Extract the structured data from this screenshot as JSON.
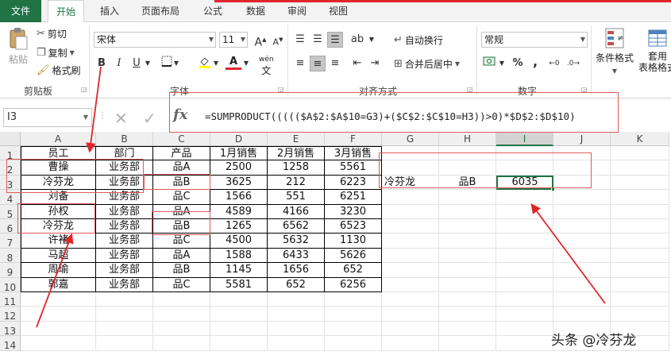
{
  "tabs": [
    {
      "label": "文件"
    },
    {
      "label": "开始"
    },
    {
      "label": "插入"
    },
    {
      "label": "页面布局"
    },
    {
      "label": "公式"
    },
    {
      "label": "数据"
    },
    {
      "label": "审阅"
    },
    {
      "label": "视图"
    }
  ],
  "ribbon": {
    "clipboard": {
      "paste": "粘贴",
      "cut": "剪切",
      "copy": "复制",
      "format_painter": "格式刷",
      "group": "剪贴板"
    },
    "font": {
      "name": "宋体",
      "size": "11",
      "bold": "B",
      "italic": "I",
      "underline": "U",
      "phonetic": "wén",
      "group": "字体"
    },
    "alignment": {
      "wrap": "自动换行",
      "merge": "合并后居中",
      "group": "对齐方式"
    },
    "number": {
      "format": "常规",
      "percent": "%",
      "comma": ",",
      "group": "数字"
    },
    "styles": {
      "conditional": "条件格式",
      "table": "套用\n表格格式"
    }
  },
  "formula_bar": {
    "name_box": "I3",
    "formula": "=SUMPRODUCT((((($A$2:$A$10=G3)+($C$2:$C$10=H3))>0)*$D$2:$D$10)"
  },
  "columns": [
    "A",
    "B",
    "C",
    "D",
    "E",
    "F",
    "G",
    "H",
    "I",
    "J",
    "K"
  ],
  "rows": [
    "1",
    "2",
    "3",
    "4",
    "5",
    "6",
    "7",
    "8",
    "9",
    "10",
    "11",
    "12",
    "13",
    "14"
  ],
  "table": {
    "headers": [
      "员工",
      "部门",
      "产品",
      "1月销售",
      "2月销售",
      "3月销售"
    ],
    "rows": [
      [
        "曹操",
        "业务部",
        "品A",
        "2500",
        "1258",
        "5561"
      ],
      [
        "冷芬龙",
        "业务部",
        "品B",
        "3625",
        "212",
        "6223"
      ],
      [
        "刘备",
        "业务部",
        "品C",
        "1566",
        "551",
        "6251"
      ],
      [
        "孙权",
        "业务部",
        "品A",
        "4589",
        "4166",
        "3230"
      ],
      [
        "冷芬龙",
        "业务部",
        "品B",
        "1265",
        "6562",
        "6523"
      ],
      [
        "许褚",
        "业务部",
        "品C",
        "4500",
        "5632",
        "1130"
      ],
      [
        "马超",
        "业务部",
        "品A",
        "1588",
        "6433",
        "5626"
      ],
      [
        "周瑜",
        "业务部",
        "品B",
        "1145",
        "1656",
        "652"
      ],
      [
        "郭嘉",
        "业务部",
        "品C",
        "5581",
        "652",
        "6256"
      ]
    ]
  },
  "lookup": {
    "employee": "冷芬龙",
    "product": "品B",
    "result": "6035"
  },
  "watermark": "头条 @冷芬龙",
  "colors": {
    "accent": "#217346",
    "annotation": "#e0262b"
  }
}
